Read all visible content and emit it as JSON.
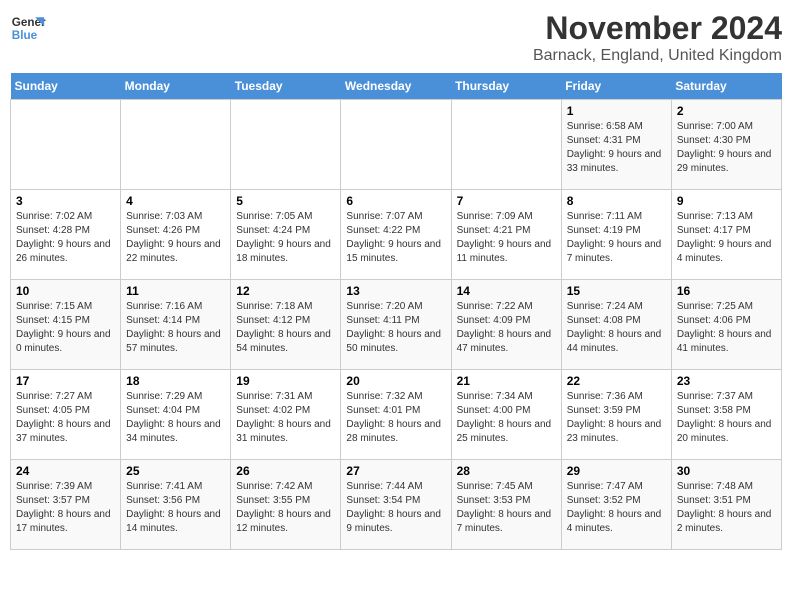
{
  "logo": {
    "line1": "General",
    "line2": "Blue"
  },
  "title": "November 2024",
  "subtitle": "Barnack, England, United Kingdom",
  "days_of_week": [
    "Sunday",
    "Monday",
    "Tuesday",
    "Wednesday",
    "Thursday",
    "Friday",
    "Saturday"
  ],
  "weeks": [
    [
      {
        "day": "",
        "sunrise": "",
        "sunset": "",
        "daylight": ""
      },
      {
        "day": "",
        "sunrise": "",
        "sunset": "",
        "daylight": ""
      },
      {
        "day": "",
        "sunrise": "",
        "sunset": "",
        "daylight": ""
      },
      {
        "day": "",
        "sunrise": "",
        "sunset": "",
        "daylight": ""
      },
      {
        "day": "",
        "sunrise": "",
        "sunset": "",
        "daylight": ""
      },
      {
        "day": "1",
        "sunrise": "Sunrise: 6:58 AM",
        "sunset": "Sunset: 4:31 PM",
        "daylight": "Daylight: 9 hours and 33 minutes."
      },
      {
        "day": "2",
        "sunrise": "Sunrise: 7:00 AM",
        "sunset": "Sunset: 4:30 PM",
        "daylight": "Daylight: 9 hours and 29 minutes."
      }
    ],
    [
      {
        "day": "3",
        "sunrise": "Sunrise: 7:02 AM",
        "sunset": "Sunset: 4:28 PM",
        "daylight": "Daylight: 9 hours and 26 minutes."
      },
      {
        "day": "4",
        "sunrise": "Sunrise: 7:03 AM",
        "sunset": "Sunset: 4:26 PM",
        "daylight": "Daylight: 9 hours and 22 minutes."
      },
      {
        "day": "5",
        "sunrise": "Sunrise: 7:05 AM",
        "sunset": "Sunset: 4:24 PM",
        "daylight": "Daylight: 9 hours and 18 minutes."
      },
      {
        "day": "6",
        "sunrise": "Sunrise: 7:07 AM",
        "sunset": "Sunset: 4:22 PM",
        "daylight": "Daylight: 9 hours and 15 minutes."
      },
      {
        "day": "7",
        "sunrise": "Sunrise: 7:09 AM",
        "sunset": "Sunset: 4:21 PM",
        "daylight": "Daylight: 9 hours and 11 minutes."
      },
      {
        "day": "8",
        "sunrise": "Sunrise: 7:11 AM",
        "sunset": "Sunset: 4:19 PM",
        "daylight": "Daylight: 9 hours and 7 minutes."
      },
      {
        "day": "9",
        "sunrise": "Sunrise: 7:13 AM",
        "sunset": "Sunset: 4:17 PM",
        "daylight": "Daylight: 9 hours and 4 minutes."
      }
    ],
    [
      {
        "day": "10",
        "sunrise": "Sunrise: 7:15 AM",
        "sunset": "Sunset: 4:15 PM",
        "daylight": "Daylight: 9 hours and 0 minutes."
      },
      {
        "day": "11",
        "sunrise": "Sunrise: 7:16 AM",
        "sunset": "Sunset: 4:14 PM",
        "daylight": "Daylight: 8 hours and 57 minutes."
      },
      {
        "day": "12",
        "sunrise": "Sunrise: 7:18 AM",
        "sunset": "Sunset: 4:12 PM",
        "daylight": "Daylight: 8 hours and 54 minutes."
      },
      {
        "day": "13",
        "sunrise": "Sunrise: 7:20 AM",
        "sunset": "Sunset: 4:11 PM",
        "daylight": "Daylight: 8 hours and 50 minutes."
      },
      {
        "day": "14",
        "sunrise": "Sunrise: 7:22 AM",
        "sunset": "Sunset: 4:09 PM",
        "daylight": "Daylight: 8 hours and 47 minutes."
      },
      {
        "day": "15",
        "sunrise": "Sunrise: 7:24 AM",
        "sunset": "Sunset: 4:08 PM",
        "daylight": "Daylight: 8 hours and 44 minutes."
      },
      {
        "day": "16",
        "sunrise": "Sunrise: 7:25 AM",
        "sunset": "Sunset: 4:06 PM",
        "daylight": "Daylight: 8 hours and 41 minutes."
      }
    ],
    [
      {
        "day": "17",
        "sunrise": "Sunrise: 7:27 AM",
        "sunset": "Sunset: 4:05 PM",
        "daylight": "Daylight: 8 hours and 37 minutes."
      },
      {
        "day": "18",
        "sunrise": "Sunrise: 7:29 AM",
        "sunset": "Sunset: 4:04 PM",
        "daylight": "Daylight: 8 hours and 34 minutes."
      },
      {
        "day": "19",
        "sunrise": "Sunrise: 7:31 AM",
        "sunset": "Sunset: 4:02 PM",
        "daylight": "Daylight: 8 hours and 31 minutes."
      },
      {
        "day": "20",
        "sunrise": "Sunrise: 7:32 AM",
        "sunset": "Sunset: 4:01 PM",
        "daylight": "Daylight: 8 hours and 28 minutes."
      },
      {
        "day": "21",
        "sunrise": "Sunrise: 7:34 AM",
        "sunset": "Sunset: 4:00 PM",
        "daylight": "Daylight: 8 hours and 25 minutes."
      },
      {
        "day": "22",
        "sunrise": "Sunrise: 7:36 AM",
        "sunset": "Sunset: 3:59 PM",
        "daylight": "Daylight: 8 hours and 23 minutes."
      },
      {
        "day": "23",
        "sunrise": "Sunrise: 7:37 AM",
        "sunset": "Sunset: 3:58 PM",
        "daylight": "Daylight: 8 hours and 20 minutes."
      }
    ],
    [
      {
        "day": "24",
        "sunrise": "Sunrise: 7:39 AM",
        "sunset": "Sunset: 3:57 PM",
        "daylight": "Daylight: 8 hours and 17 minutes."
      },
      {
        "day": "25",
        "sunrise": "Sunrise: 7:41 AM",
        "sunset": "Sunset: 3:56 PM",
        "daylight": "Daylight: 8 hours and 14 minutes."
      },
      {
        "day": "26",
        "sunrise": "Sunrise: 7:42 AM",
        "sunset": "Sunset: 3:55 PM",
        "daylight": "Daylight: 8 hours and 12 minutes."
      },
      {
        "day": "27",
        "sunrise": "Sunrise: 7:44 AM",
        "sunset": "Sunset: 3:54 PM",
        "daylight": "Daylight: 8 hours and 9 minutes."
      },
      {
        "day": "28",
        "sunrise": "Sunrise: 7:45 AM",
        "sunset": "Sunset: 3:53 PM",
        "daylight": "Daylight: 8 hours and 7 minutes."
      },
      {
        "day": "29",
        "sunrise": "Sunrise: 7:47 AM",
        "sunset": "Sunset: 3:52 PM",
        "daylight": "Daylight: 8 hours and 4 minutes."
      },
      {
        "day": "30",
        "sunrise": "Sunrise: 7:48 AM",
        "sunset": "Sunset: 3:51 PM",
        "daylight": "Daylight: 8 hours and 2 minutes."
      }
    ]
  ]
}
